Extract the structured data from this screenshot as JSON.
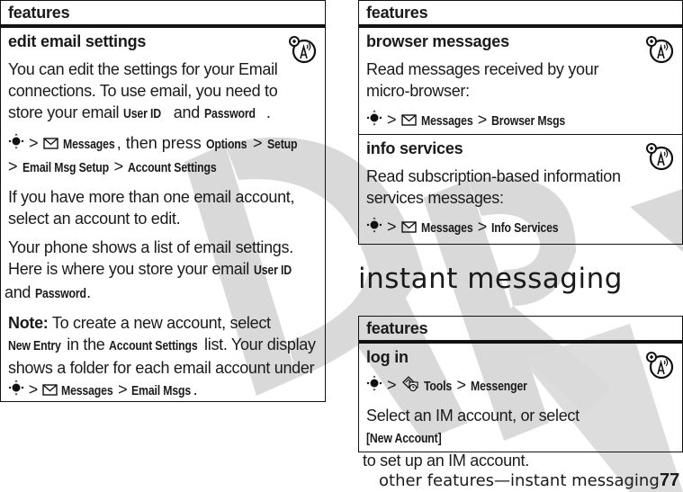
{
  "watermark": "DRAFT",
  "left_table": {
    "header": "features",
    "row": {
      "title": "edit email settings",
      "intro": [
        "You can edit the settings for your Email connections. To use email, you need to store your email ",
        "User ID",
        " and ",
        "Password",
        "."
      ],
      "nav": {
        "messages": "Messages",
        "then_press": ", then press ",
        "options": "Options",
        "setup": "Setup",
        "email_msg_setup": "Email Msg Setup",
        "account_settings": "Account Settings"
      },
      "multi": "If you have more than one email account, select an account to edit.",
      "shows": [
        "Your phone shows a list of email settings. Here is where you store your email ",
        "User ID",
        " and ",
        "Password",
        "."
      ],
      "note": {
        "label": "Note:",
        "t1": " To create a new account, select ",
        "new_entry": "New Entry",
        "t2": " in the ",
        "account_settings": "Account Settings",
        "t3": " list. Your display shows a folder for each email account under ",
        "messages": "Messages",
        "email_msgs": "Email Msgs",
        "t4": "."
      }
    }
  },
  "right_table": {
    "header": "features",
    "rows": [
      {
        "title": "browser messages",
        "text": "Read messages received by your micro-browser:",
        "nav": [
          "Messages",
          "Browser Msgs"
        ]
      },
      {
        "title": "info services",
        "text": "Read subscription-based information services messages:",
        "nav": [
          "Messages",
          "Info Services"
        ]
      }
    ]
  },
  "section_title": "instant messaging",
  "im_table": {
    "header": "features",
    "row": {
      "title": "log in",
      "nav": [
        "Tools",
        "Messenger"
      ],
      "text1": "Select an IM account, or select ",
      "new_account": "[New Account]",
      "text2": " to set up an IM account."
    }
  },
  "footer": {
    "text": "other features—instant messaging",
    "page": "77"
  },
  "symbols": {
    "gt": ">"
  }
}
